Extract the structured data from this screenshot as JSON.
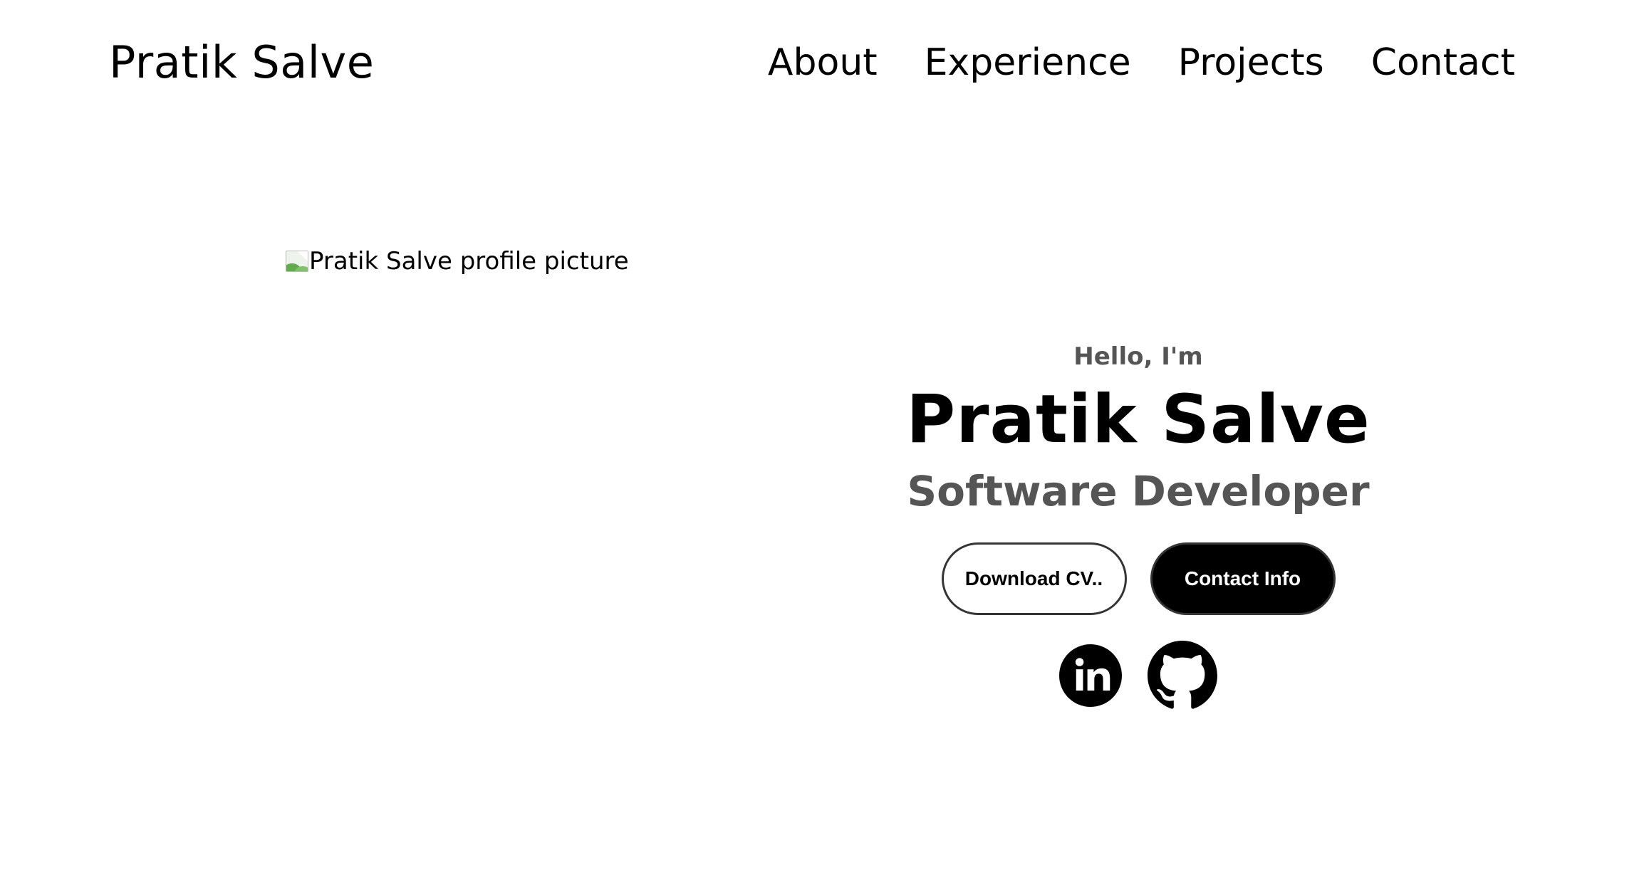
{
  "header": {
    "logo_text": "Pratik Salve",
    "nav": [
      {
        "label": "About"
      },
      {
        "label": "Experience"
      },
      {
        "label": "Projects"
      },
      {
        "label": "Contact"
      }
    ]
  },
  "profile": {
    "image_alt": "Pratik Salve profile picture",
    "icon": "broken-image-icon"
  },
  "hero": {
    "greeting": "Hello, I'm",
    "name": "Pratik Salve",
    "role": "Software Developer",
    "buttons": {
      "download_cv": "Download CV..",
      "contact_info": "Contact Info"
    },
    "socials": [
      {
        "icon": "linkedin-icon"
      },
      {
        "icon": "github-icon"
      }
    ]
  },
  "colors": {
    "background": "#ffffff",
    "text_primary": "#000000",
    "text_secondary": "#555555",
    "button_border": "#353535"
  }
}
